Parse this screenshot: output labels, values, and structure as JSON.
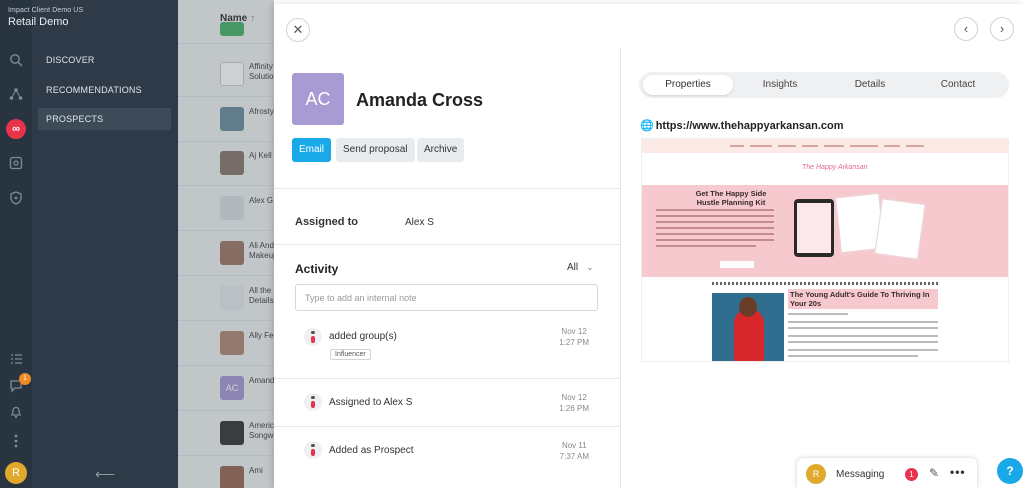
{
  "org": {
    "sub": "Impact Client Demo US",
    "name": "Retail Demo"
  },
  "nav": {
    "discover": "DISCOVER",
    "recommendations": "RECOMMENDATIONS",
    "prospects": "PROSPECTS"
  },
  "rail": {
    "chat_badge": "1",
    "user_initial": "R"
  },
  "list": {
    "header": "Name",
    "sort_icon": "↑",
    "rows": [
      {
        "name": "Affinity Solutions"
      },
      {
        "name": "Afrosty"
      },
      {
        "name": "Aj Kell"
      },
      {
        "name": "Alex G"
      },
      {
        "name": "Ali And Makeup"
      },
      {
        "name": "All the Details"
      },
      {
        "name": "Ally Fe"
      },
      {
        "name": "Amanda",
        "initials": "AC"
      },
      {
        "name": "Americ Songw"
      },
      {
        "name": "Ami"
      }
    ]
  },
  "contact": {
    "initials": "AC",
    "name": "Amanda Cross",
    "actions": {
      "email": "Email",
      "send_proposal": "Send proposal",
      "archive": "Archive"
    },
    "assigned_label": "Assigned to",
    "assigned_value": "Alex S"
  },
  "activity": {
    "title": "Activity",
    "filter": "All",
    "note_placeholder": "Type to add an internal note",
    "items": [
      {
        "text": "added group(s)",
        "tag": "Influencer",
        "date": "Nov 12",
        "time": "1:27 PM"
      },
      {
        "text": "Assigned to Alex S",
        "date": "Nov 12",
        "time": "1:26 PM"
      },
      {
        "text": "Added as Prospect",
        "date": "Nov 11",
        "time": "7:37 AM"
      }
    ]
  },
  "tabs": {
    "properties": "Properties",
    "insights": "Insights",
    "details": "Details",
    "contact": "Contact"
  },
  "website": {
    "url": "https://www.thehappyarkansan.com"
  },
  "preview": {
    "logo": "The Happy Arkansan",
    "headline": "Get The Happy Side Hustle Planning Kit",
    "post_title": "The Young Adult's Guide To Thriving In Your 20s"
  },
  "messaging": {
    "label": "Messaging",
    "badge": "1",
    "avatar": "R"
  },
  "help": {
    "label": "?"
  },
  "colors": {
    "accent": "#1aa9e8",
    "sidebar": "#2e3a47",
    "avatar": "#a89bd3",
    "alert": "#e8334a"
  }
}
